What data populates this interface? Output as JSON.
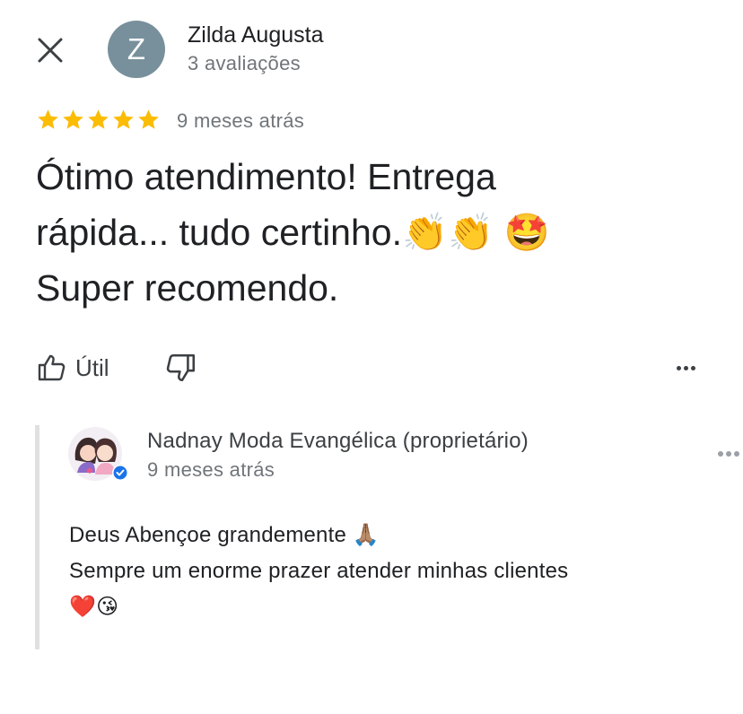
{
  "reviewer": {
    "initial": "Z",
    "name": "Zilda Augusta",
    "reviews_count": "3 avaliações",
    "avatar_color": "#78909c"
  },
  "review": {
    "rating": 5,
    "date": "9 meses atrás",
    "text": "Ótimo atendimento! Entrega\nrápida... tudo certinho.👏👏 🤩\nSuper recomendo."
  },
  "actions": {
    "useful_label": "Útil",
    "like_icon": "thumb-up-icon",
    "dislike_icon": "thumb-down-icon",
    "more_icon": "more-horizontal-icon"
  },
  "owner_reply": {
    "name": "Nadnay Moda Evangélica (proprietário)",
    "date": "9 meses atrás",
    "text": "Deus Abençoe grandemente 🙏🏽\nSempre um enorme prazer atender minhas clientes\n❤️😘",
    "verified_color": "#1a73e8"
  },
  "colors": {
    "star": "#fbbc04",
    "secondary_text": "#70757a",
    "reply_bar": "#e0e0e0"
  }
}
